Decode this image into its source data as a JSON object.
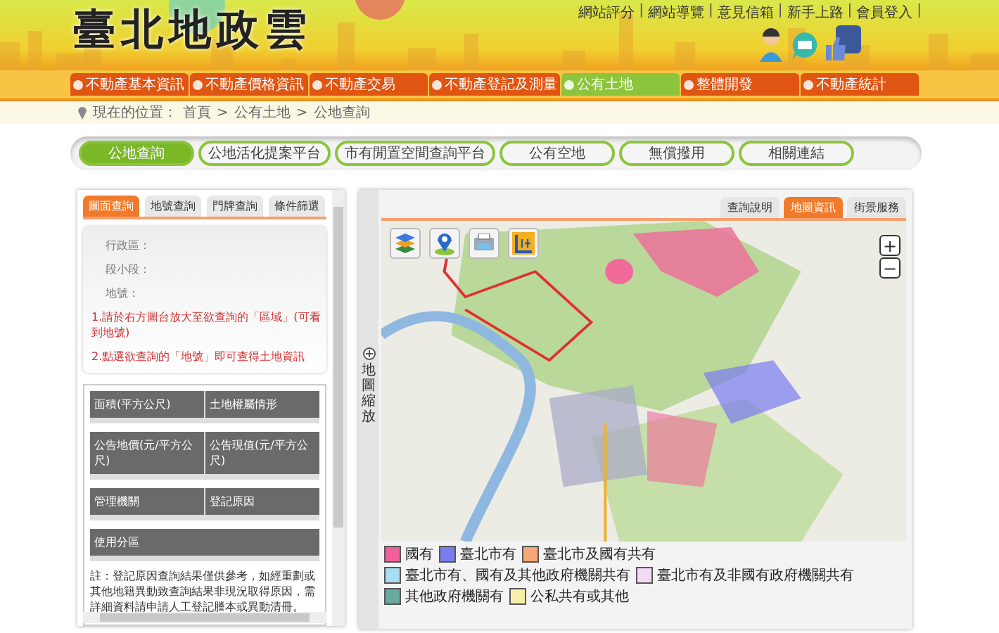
{
  "header": {
    "logo": "臺北地政雲",
    "links": [
      {
        "label": "網站評分",
        "separator": "|"
      },
      {
        "label": "網站導覽",
        "separator": "|"
      },
      {
        "label": "意見信箱",
        "separator": "|"
      },
      {
        "label": "新手上路",
        "separator": "|"
      },
      {
        "label": "會員登入",
        "separator": "|"
      }
    ]
  },
  "nav": [
    {
      "label": "不動產基本資訊",
      "selected": false
    },
    {
      "label": "不動產價格資訊",
      "selected": false
    },
    {
      "label": "不動產交易",
      "selected": false
    },
    {
      "label": "不動產登記及測量",
      "selected": false
    },
    {
      "label": "公有土地",
      "selected": true
    },
    {
      "label": "整體開發",
      "selected": false
    },
    {
      "label": "不動產統計",
      "selected": false
    }
  ],
  "breadcrumb": {
    "label": "現在的位置：",
    "path": [
      {
        "label": "首頁"
      },
      {
        "separator": ">",
        "label": "公有土地"
      },
      {
        "separator": ">",
        "label": "公地查詢"
      }
    ]
  },
  "subnav": [
    {
      "label": "公地查詢",
      "selected": true
    },
    {
      "label": "公地活化提案平台",
      "selected": false
    },
    {
      "label": "市有閒置空間查詢平台",
      "selected": false
    },
    {
      "label": "公有空地",
      "selected": false
    },
    {
      "label": "無償撥用",
      "selected": false
    },
    {
      "label": "相關連結",
      "selected": false
    }
  ],
  "left_panel": {
    "tabs": [
      {
        "label": "圖面查詢",
        "selected": true
      },
      {
        "label": "地號查詢",
        "selected": false
      },
      {
        "label": "門牌查詢",
        "selected": false
      },
      {
        "label": "條件篩選",
        "selected": false
      }
    ],
    "fields": [
      "行政區：",
      "段小段：",
      "地號："
    ],
    "instructions": [
      "1.請於右方圖台放大至欲查詢的「區域」(可看到地號)",
      "2.點選欲查詢的「地號」即可查得土地資訊"
    ],
    "info_table": [
      [
        "面積(平方公尺)",
        "土地權屬情形"
      ],
      [
        "公告地價(元/平方公尺)",
        "公告現值(元/平方公尺)"
      ],
      [
        "管理機關",
        "登記原因"
      ],
      [
        "使用分區"
      ]
    ],
    "note": "註：登記原因查詢結果僅供參考，如經重劃或其他地籍異動致查詢結果非現況取得原因，需詳細資料請申請人工登記謄本或異動清冊。"
  },
  "map_panel": {
    "zoom_label": "地圖縮放",
    "tabs": [
      {
        "label": "查詢說明",
        "selected": false
      },
      {
        "label": "地圖資訊",
        "selected": true
      },
      {
        "label": "街景服務",
        "selected": false
      }
    ],
    "zoom_in": "+",
    "zoom_out": "−",
    "legend": [
      {
        "label": "國有",
        "color": "#f0609a"
      },
      {
        "label": "臺北市有",
        "color": "#7b7cf0"
      },
      {
        "label": "臺北市及國有共有",
        "color": "#f5a878"
      },
      {
        "label": "臺北市有、國有及其他政府機關共有",
        "color": "#a8dcf0"
      },
      {
        "label": "臺北市有及非國有政府機關共有",
        "color": "#f3dcf3"
      },
      {
        "label": "其他政府機關有",
        "color": "#6aa8a0"
      },
      {
        "label": "公私共有或其他",
        "color": "#f8f0a8"
      }
    ]
  }
}
